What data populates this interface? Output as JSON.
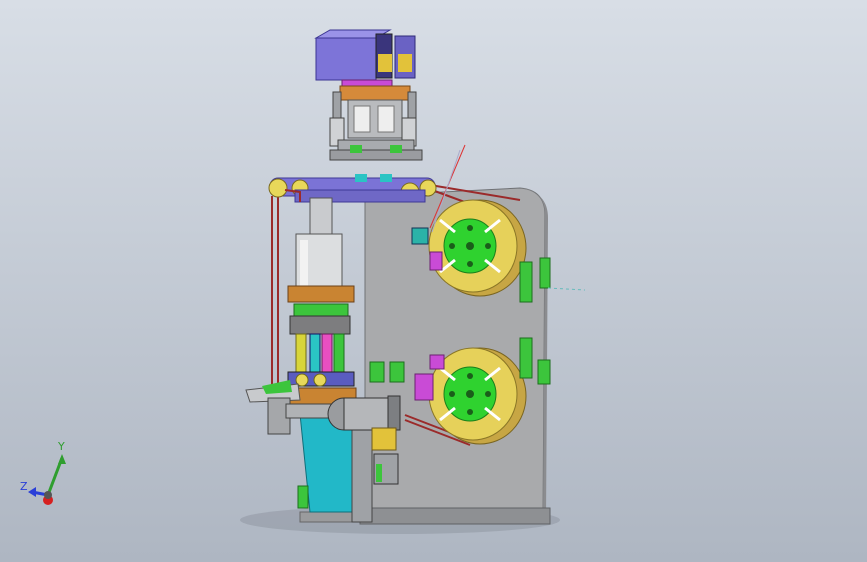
{
  "view": {
    "background_top": "#d8dee6",
    "background_bottom": "#aeb6c2"
  },
  "triad": {
    "y_label": "Y",
    "z_label": "Z",
    "y_color": "#2f9e2f",
    "z_color": "#2a3fd8",
    "x_color": "#d62020"
  },
  "model": {
    "plate_color": "#a9aaac",
    "reel_color": "#e6d15a",
    "hub_color": "#2fd22f",
    "purple_color": "#7d74d8",
    "cyan_color": "#22b8c8",
    "orange_color": "#c98432",
    "belt_color": "#9b2a2a"
  }
}
